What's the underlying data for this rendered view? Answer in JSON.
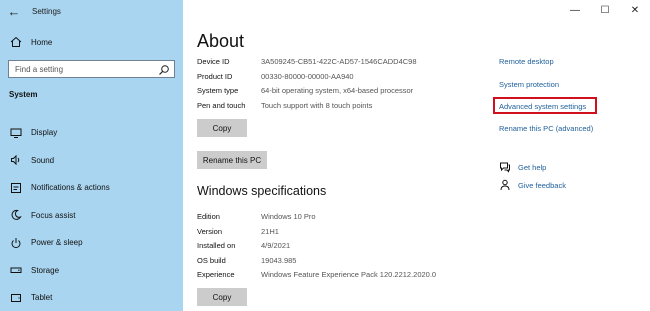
{
  "window": {
    "app_title": "Settings",
    "back_icon": "←",
    "minimize_icon": "—",
    "maximize_icon": "☐",
    "close_icon": "✕"
  },
  "sidebar": {
    "home_label": "Home",
    "search_placeholder": "Find a setting",
    "section_label": "System",
    "items": [
      {
        "label": "Display",
        "icon": "display-icon"
      },
      {
        "label": "Sound",
        "icon": "sound-icon"
      },
      {
        "label": "Notifications & actions",
        "icon": "notifications-icon"
      },
      {
        "label": "Focus assist",
        "icon": "focus-assist-icon"
      },
      {
        "label": "Power & sleep",
        "icon": "power-icon"
      },
      {
        "label": "Storage",
        "icon": "storage-icon"
      },
      {
        "label": "Tablet",
        "icon": "tablet-icon"
      }
    ]
  },
  "main": {
    "title": "About",
    "device_specs": [
      {
        "key": "Device ID",
        "value": "3A509245-CB51-422C-AD57-1546CADD4C98"
      },
      {
        "key": "Product ID",
        "value": "00330-80000-00000-AA940"
      },
      {
        "key": "System type",
        "value": "64-bit operating system, x64-based processor"
      },
      {
        "key": "Pen and touch",
        "value": "Touch support with 8 touch points"
      }
    ],
    "copy_button_1": "Copy",
    "rename_button": "Rename this PC",
    "windows_specs_title": "Windows specifications",
    "windows_specs": [
      {
        "key": "Edition",
        "value": "Windows 10 Pro"
      },
      {
        "key": "Version",
        "value": "21H1"
      },
      {
        "key": "Installed on",
        "value": "4/9/2021"
      },
      {
        "key": "OS build",
        "value": "19043.985"
      },
      {
        "key": "Experience",
        "value": "Windows Feature Experience Pack 120.2212.2020.0"
      }
    ],
    "copy_button_2": "Copy"
  },
  "related": {
    "remote_desktop": "Remote desktop",
    "system_protection": "System protection",
    "advanced_system_settings": "Advanced system settings",
    "rename_advanced": "Rename this PC (advanced)",
    "get_help": "Get help",
    "give_feedback": "Give feedback"
  },
  "colors": {
    "sidebar_bg": "#a9d5f0",
    "link": "#1f5f9a",
    "highlight": "#d0101e",
    "button_bg": "#cccccc"
  }
}
